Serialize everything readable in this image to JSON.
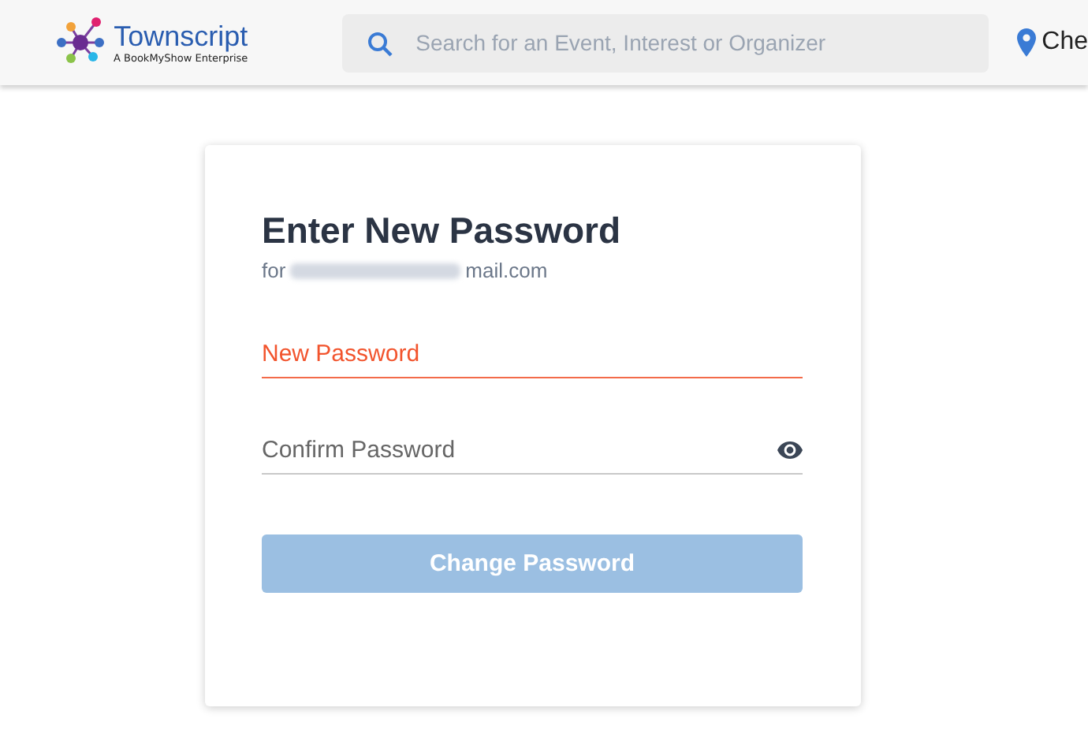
{
  "header": {
    "logo": {
      "name": "Townscript",
      "tagline": "A BookMyShow Enterprise"
    },
    "search": {
      "placeholder": "Search for an Event, Interest or Organizer"
    },
    "location": "Che"
  },
  "form": {
    "title": "Enter New Password",
    "for_prefix": "for",
    "email_suffix": "mail.com",
    "fields": [
      {
        "placeholder": "New Password",
        "focused": true,
        "has_eye": false
      },
      {
        "placeholder": "Confirm Password",
        "focused": false,
        "has_eye": true
      }
    ],
    "button": {
      "label": "Change Password",
      "disabled": true
    }
  }
}
